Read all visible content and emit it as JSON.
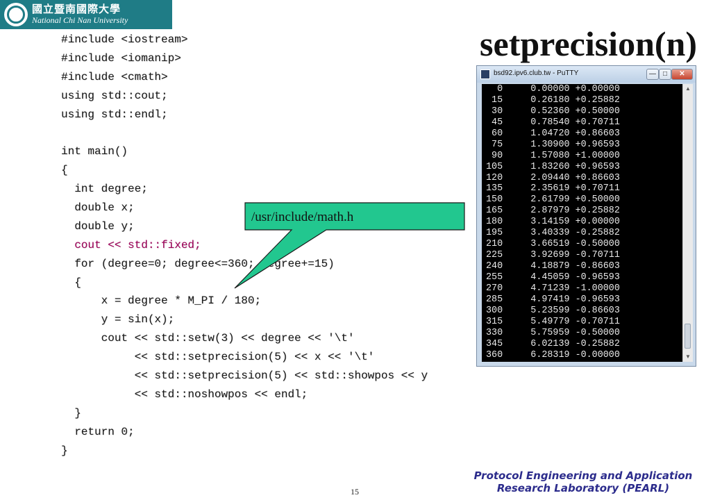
{
  "logo": {
    "chinese_name": "國立暨南國際大學",
    "english_name": "National Chi Nan University"
  },
  "slide": {
    "title": "setprecision(n)",
    "page_number": "15"
  },
  "code_lines": [
    "#include <iostream>",
    "#include <iomanip>",
    "#include <cmath>",
    "using std::cout;",
    "using std::endl;",
    "",
    "int main()",
    "{",
    "  int degree;",
    "  double x;",
    "  double y;",
    "  cout << std::fixed;",
    "  for (degree=0; degree<=360; degree+=15)",
    "  {",
    "      x = degree * M_PI / 180;",
    "      y = sin(x);",
    "      cout << std::setw(3) << degree << '\\t'",
    "           << std::setprecision(5) << x << '\\t'",
    "           << std::setprecision(5) << std::showpos << y",
    "           << std::noshowpos << endl;",
    "  }",
    "  return 0;",
    "}"
  ],
  "callout": {
    "text": "/usr/include/math.h",
    "fill_color": "#22c78f",
    "border_color": "#1a1a1a"
  },
  "terminal": {
    "window_title": "bsd92.ipv6.club.tw - PuTTY",
    "minimize_label": "—",
    "maximize_label": "□",
    "close_label": "✕",
    "lines": [
      "  0     0.00000 +0.00000",
      " 15     0.26180 +0.25882",
      " 30     0.52360 +0.50000",
      " 45     0.78540 +0.70711",
      " 60     1.04720 +0.86603",
      " 75     1.30900 +0.96593",
      " 90     1.57080 +1.00000",
      "105     1.83260 +0.96593",
      "120     2.09440 +0.86603",
      "135     2.35619 +0.70711",
      "150     2.61799 +0.50000",
      "165     2.87979 +0.25882",
      "180     3.14159 +0.00000",
      "195     3.40339 -0.25882",
      "210     3.66519 -0.50000",
      "225     3.92699 -0.70711",
      "240     4.18879 -0.86603",
      "255     4.45059 -0.96593",
      "270     4.71239 -1.00000",
      "285     4.97419 -0.96593",
      "300     5.23599 -0.86603",
      "315     5.49779 -0.70711",
      "330     5.75959 -0.50000",
      "345     6.02139 -0.25882",
      "360     6.28319 -0.00000"
    ]
  },
  "footer": {
    "line1": "Protocol Engineering and Application",
    "line2": "Research Laboratory (PEARL)"
  },
  "colors": {
    "logo_bg": "#1f7c86",
    "footer_text": "#2c2c8c",
    "terminal_bg": "#000000",
    "terminal_text": "#e8e8e8"
  }
}
